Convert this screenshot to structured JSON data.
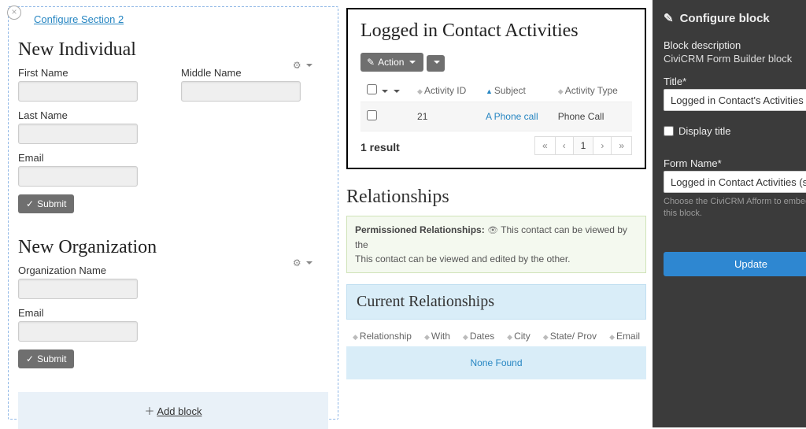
{
  "section_link": "Configure Section 2",
  "left": {
    "individual": {
      "title": "New Individual",
      "fields": {
        "first": "First Name",
        "middle": "Middle Name",
        "last": "Last Name",
        "email": "Email"
      },
      "submit": "Submit"
    },
    "organization": {
      "title": "New Organization",
      "fields": {
        "org": "Organization Name",
        "email": "Email"
      },
      "submit": "Submit"
    },
    "add_block": "Add block"
  },
  "activities": {
    "title": "Logged in Contact Activities",
    "action_btn": "Action",
    "cols": {
      "id": "Activity ID",
      "subject": "Subject",
      "type": "Activity Type"
    },
    "row": {
      "id": "21",
      "subject": "A Phone call",
      "type": "Phone Call"
    },
    "result_text": "1 result",
    "pager": {
      "first": "«",
      "prev": "‹",
      "page": "1",
      "next": "›",
      "last": "»"
    }
  },
  "relationships": {
    "title": "Relationships",
    "perm_label": "Permissioned Relationships:",
    "perm_line1": "This contact can be viewed by the",
    "perm_line2": "This contact can be viewed and edited by the other.",
    "current_title": "Current Relationships",
    "cols": {
      "rel": "Relationship",
      "with": "With",
      "dates": "Dates",
      "city": "City",
      "state": "State/\nProv",
      "email": "Email"
    },
    "none": "None Found"
  },
  "panel": {
    "header": "Configure block",
    "desc_label": "Block description",
    "desc_value": "CiviCRM Form Builder block",
    "title_label": "Title*",
    "title_value": "Logged in Contact's Activities",
    "display_title": "Display title",
    "form_label": "Form Name*",
    "form_value": "Logged in Contact Activities (search)",
    "form_help": "Choose the CiviCRM Afform to embed for this block.",
    "update": "Update"
  }
}
